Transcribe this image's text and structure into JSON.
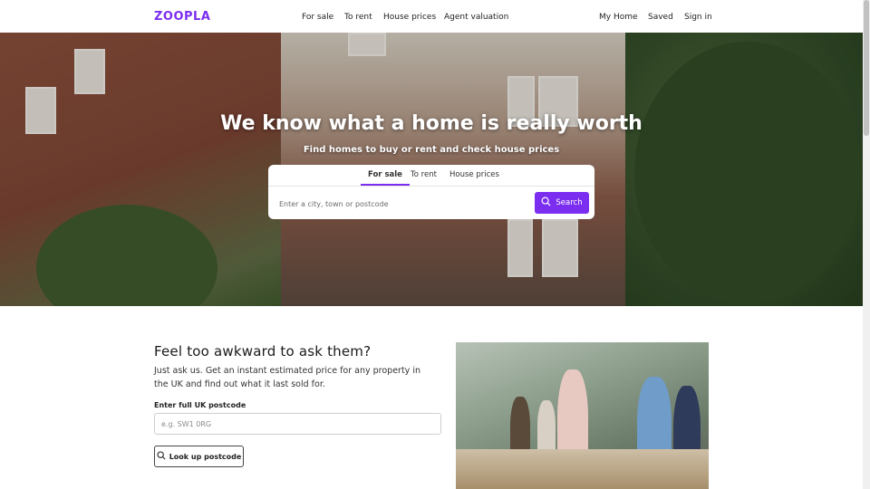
{
  "header": {
    "logo": "ZOOPLA",
    "nav_primary": [
      "For sale",
      "To rent",
      "House prices",
      "Agent valuation"
    ],
    "nav_secondary": [
      "My Home",
      "Saved",
      "Sign in"
    ]
  },
  "hero": {
    "title": "We know what a home is really worth",
    "subtitle": "Find homes to buy or rent and check house prices",
    "tabs": [
      "For sale",
      "To rent",
      "House prices"
    ],
    "active_tab": "For sale",
    "search_placeholder": "Enter a city, town or postcode",
    "search_button": "Search"
  },
  "valuation": {
    "title": "Feel too awkward to ask them?",
    "description": "Just ask us. Get an instant estimated price for any property in the UK and find out what it last sold for.",
    "postcode_label": "Enter full UK postcode",
    "postcode_placeholder": "e.g. SW1 0RG",
    "lookup_button": "Look up postcode"
  },
  "colors": {
    "brand": "#7b2ef0",
    "text": "#1f1f1f"
  },
  "icons": [
    "search-icon"
  ]
}
